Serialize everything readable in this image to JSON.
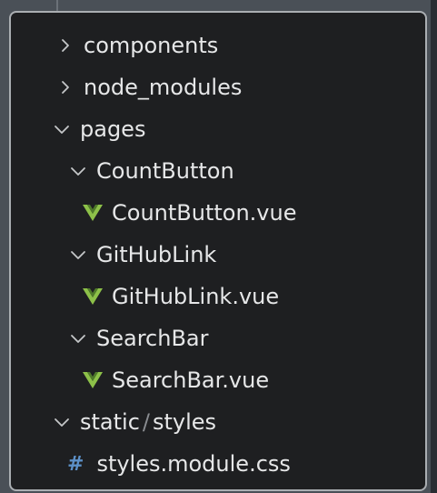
{
  "explorer": {
    "items": [
      {
        "label": "components",
        "type": "folder",
        "expanded": false
      },
      {
        "label": "node_modules",
        "type": "folder",
        "expanded": false
      },
      {
        "label": "pages",
        "type": "folder",
        "expanded": true
      },
      {
        "label": "CountButton",
        "type": "folder",
        "expanded": true
      },
      {
        "label": "CountButton.vue",
        "type": "vue-file"
      },
      {
        "label": "GitHubLink",
        "type": "folder",
        "expanded": true
      },
      {
        "label": "GitHubLink.vue",
        "type": "vue-file"
      },
      {
        "label": "SearchBar",
        "type": "folder",
        "expanded": true
      },
      {
        "label": "SearchBar.vue",
        "type": "vue-file"
      },
      {
        "label_parent": "static",
        "label_sep": "/",
        "label_child": "styles",
        "type": "folder",
        "expanded": true
      },
      {
        "label": "styles.module.css",
        "type": "css-file",
        "icon_text": "#"
      }
    ]
  },
  "colors": {
    "panel_bg": "#1e1f21",
    "text": "#e6e7e8",
    "vue_green": "#8dc149",
    "css_blue": "#5c90c8",
    "chevron": "#c5c7c9"
  }
}
